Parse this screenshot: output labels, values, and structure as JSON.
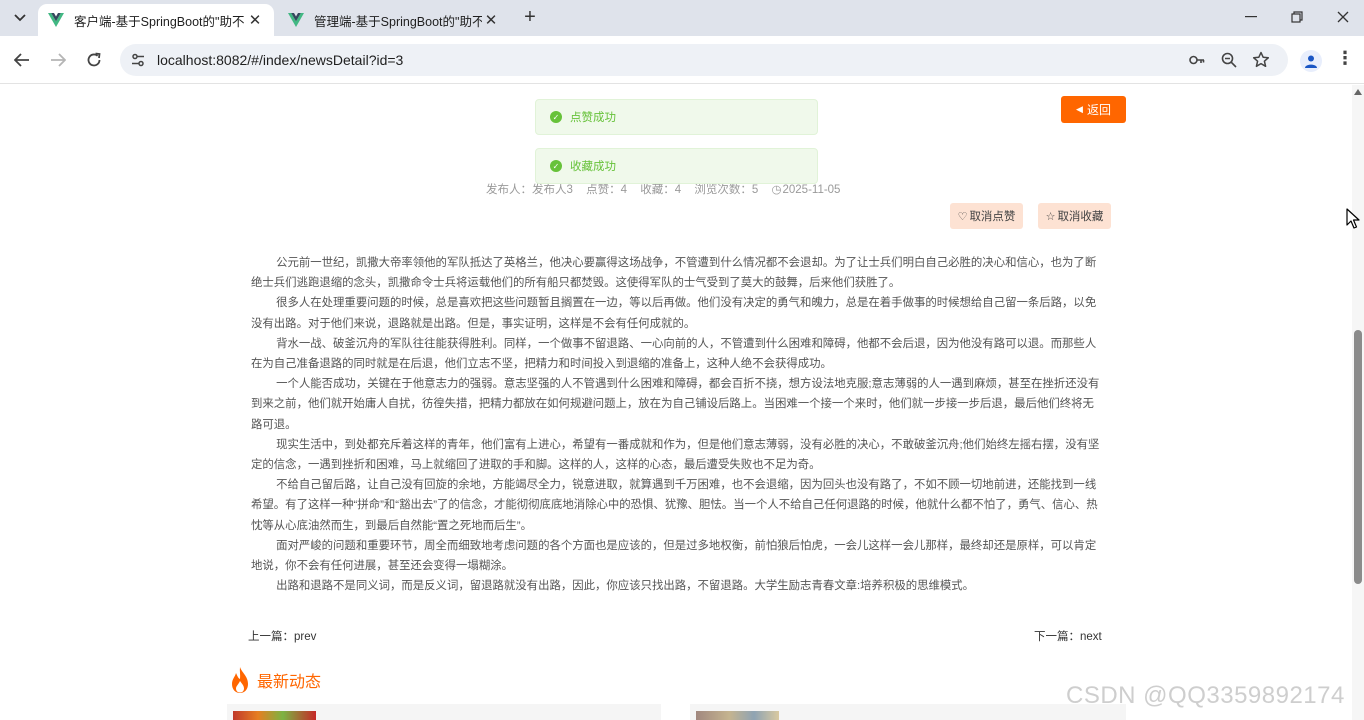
{
  "browser": {
    "tabs": [
      {
        "title": "客户端-基于SpringBoot的\"助不",
        "active": true
      },
      {
        "title": "管理端-基于SpringBoot的\"助不",
        "active": false
      }
    ],
    "url": "localhost:8082/#/index/newsDetail?id=3"
  },
  "page": {
    "back_label": "返回",
    "toasts": [
      "点赞成功",
      "收藏成功"
    ],
    "meta": {
      "publisher": "发布人：发布人3",
      "likes": "点赞：4",
      "favorites": "收藏：4",
      "views": "浏览次数：5",
      "date": "2025-11-05"
    },
    "actions": {
      "unlike": "取消点赞",
      "unfavorite": "取消收藏"
    },
    "paragraphs": [
      "公元前一世纪，凯撒大帝率领他的军队抵达了英格兰，他决心要赢得这场战争，不管遭到什么情况都不会退却。为了让士兵们明白自己必胜的决心和信心，也为了断绝士兵们逃跑退缩的念头，凯撒命令士兵将运载他们的所有船只都焚毁。这使得军队的士气受到了莫大的鼓舞，后来他们获胜了。",
      "很多人在处理重要问题的时候，总是喜欢把这些问题暂且搁置在一边，等以后再做。他们没有决定的勇气和魄力，总是在着手做事的时候想给自己留一条后路，以免没有出路。对于他们来说，退路就是出路。但是，事实证明，这样是不会有任何成就的。",
      "背水一战、破釜沉舟的军队往往能获得胜利。同样，一个做事不留退路、一心向前的人，不管遭到什么困难和障碍，他都不会后退，因为他没有路可以退。而那些人在为自己准备退路的同时就是在后退，他们立志不坚，把精力和时间投入到退缩的准备上，这种人绝不会获得成功。",
      "一个人能否成功，关键在于他意志力的强弱。意志坚强的人不管遇到什么困难和障碍，都会百折不挠，想方设法地克服;意志薄弱的人一遇到麻烦，甚至在挫折还没有到来之前，他们就开始庸人自扰，彷徨失措，把精力都放在如何规避问题上，放在为自己铺设后路上。当困难一个接一个来时，他们就一步接一步后退，最后他们终将无路可退。",
      "现实生活中，到处都充斥着这样的青年，他们富有上进心，希望有一番成就和作为，但是他们意志薄弱，没有必胜的决心，不敢破釜沉舟;他们始终左摇右摆，没有坚定的信念，一遇到挫折和困难，马上就缩回了进取的手和脚。这样的人，这样的心态，最后遭受失败也不足为奇。",
      "不给自己留后路，让自己没有回旋的余地，方能竭尽全力，锐意进取，就算遇到千万困难，也不会退缩，因为回头也没有路了，不如不顾一切地前进，还能找到一线希望。有了这样一种“拼命”和“豁出去”了的信念，才能彻彻底底地消除心中的恐惧、犹豫、胆怯。当一个人不给自己任何退路的时候，他就什么都不怕了，勇气、信心、热忱等从心底油然而生，到最后自然能“置之死地而后生”。",
      "面对严峻的问题和重要环节，周全而细致地考虑问题的各个方面也是应该的，但是过多地权衡，前怕狼后怕虎，一会儿这样一会儿那样，最终却还是原样，可以肯定地说，你不会有任何进展，甚至还会变得一塌糊涂。",
      "出路和退路不是同义词，而是反义词，留退路就没有出路，因此，你应该只找出路，不留退路。大学生励志青春文章:培养积极的思维模式。"
    ],
    "prev": "上一篇：prev",
    "next": "下一篇：next",
    "latest_title": "最新动态"
  },
  "watermark": "CSDN @QQ3359892174",
  "colors": {
    "accent": "#ff6600",
    "success": "#67c23a",
    "pill_bg": "#fde2d3"
  }
}
